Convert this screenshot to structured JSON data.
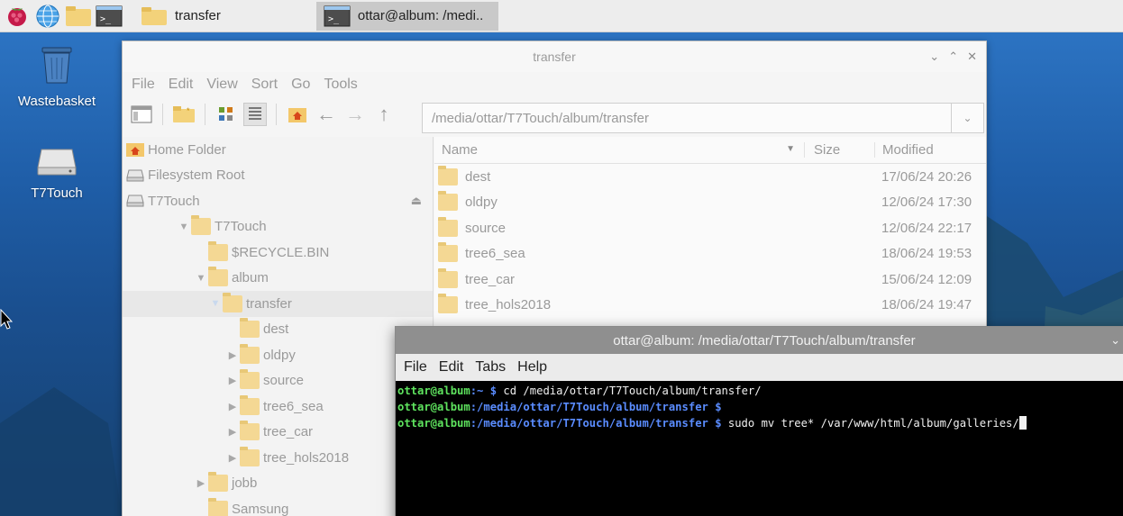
{
  "taskbar": {
    "apps": [
      {
        "icon": "raspberry-pi-menu-icon"
      },
      {
        "icon": "web-browser-icon"
      },
      {
        "icon": "file-manager-icon"
      },
      {
        "icon": "terminal-icon"
      }
    ],
    "tasks": [
      {
        "label": "transfer",
        "icon": "folder-icon",
        "active": false
      },
      {
        "label": "ottar@album: /medi..",
        "icon": "terminal-icon",
        "active": true
      }
    ]
  },
  "desktop": {
    "icons": [
      {
        "label": "Wastebasket",
        "icon": "wastebasket-icon"
      },
      {
        "label": "T7Touch",
        "icon": "drive-icon"
      }
    ]
  },
  "file_manager": {
    "title": "transfer",
    "menu": [
      "File",
      "Edit",
      "View",
      "Sort",
      "Go",
      "Tools"
    ],
    "path": "/media/ottar/T7Touch/album/transfer",
    "places": [
      {
        "label": "Home Folder",
        "icon": "home-icon"
      },
      {
        "label": "Filesystem Root",
        "icon": "drive-icon"
      },
      {
        "label": "T7Touch",
        "icon": "drive-icon"
      }
    ],
    "tree": [
      {
        "label": "T7Touch",
        "level": 0,
        "arrow": "▼"
      },
      {
        "label": "$RECYCLE.BIN",
        "level": 1,
        "arrow": ""
      },
      {
        "label": "album",
        "level": 1,
        "arrow": "▼"
      },
      {
        "label": "transfer",
        "level": 2,
        "arrow": "▼",
        "selected": true
      },
      {
        "label": "dest",
        "level": 3,
        "arrow": ""
      },
      {
        "label": "oldpy",
        "level": 3,
        "arrow": "▶"
      },
      {
        "label": "source",
        "level": 3,
        "arrow": "▶"
      },
      {
        "label": "tree6_sea",
        "level": 3,
        "arrow": "▶"
      },
      {
        "label": "tree_car",
        "level": 3,
        "arrow": "▶"
      },
      {
        "label": "tree_hols2018",
        "level": 3,
        "arrow": "▶"
      },
      {
        "label": "jobb",
        "level": 1,
        "arrow": "▶"
      },
      {
        "label": "Samsung",
        "level": 1,
        "arrow": ""
      }
    ],
    "columns": {
      "name": "Name",
      "size": "Size",
      "modified": "Modified"
    },
    "files": [
      {
        "name": "dest",
        "modified": "17/06/24 20:26"
      },
      {
        "name": "oldpy",
        "modified": "12/06/24 17:30"
      },
      {
        "name": "source",
        "modified": "12/06/24 22:17"
      },
      {
        "name": "tree6_sea",
        "modified": "18/06/24 19:53"
      },
      {
        "name": "tree_car",
        "modified": "15/06/24 12:09"
      },
      {
        "name": "tree_hols2018",
        "modified": "18/06/24 19:47"
      }
    ]
  },
  "terminal": {
    "title": "ottar@album: /media/ottar/T7Touch/album/transfer",
    "menu": [
      "File",
      "Edit",
      "Tabs",
      "Help"
    ],
    "lines": [
      {
        "prompt": "ottar@album",
        "path": ":~ $",
        "cmd": " cd /media/ottar/T7Touch/album/transfer/"
      },
      {
        "prompt": "ottar@album",
        "path": ":/media/ottar/T7Touch/album/transfer $",
        "cmd": ""
      },
      {
        "prompt": "ottar@album",
        "path": ":/media/ottar/T7Touch/album/transfer $",
        "cmd": " sudo mv tree* /var/www/html/album/galleries/"
      }
    ]
  }
}
